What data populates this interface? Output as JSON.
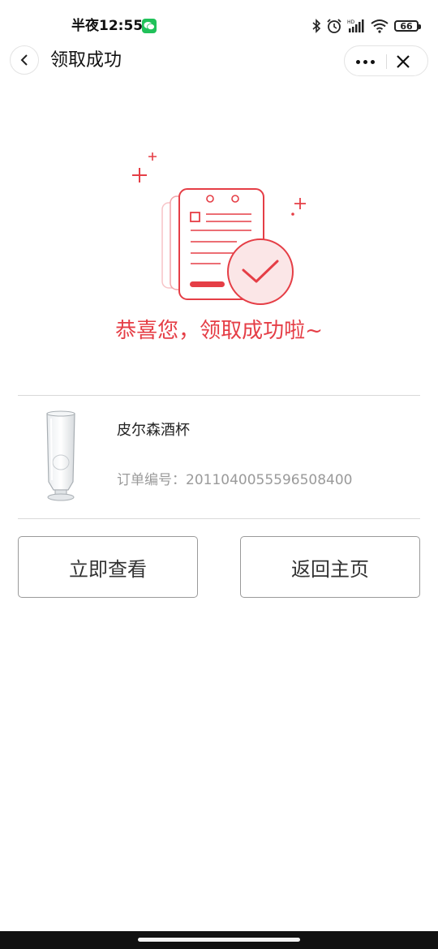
{
  "status_bar": {
    "time": "半夜12:55",
    "battery": "66"
  },
  "nav": {
    "title": "领取成功"
  },
  "result": {
    "message": "恭喜您，领取成功啦~"
  },
  "product": {
    "name": "皮尔森酒杯",
    "order_label": "订单编号：",
    "order_number": "2011040055596508400"
  },
  "buttons": {
    "view": "立即查看",
    "home": "返回主页"
  },
  "colors": {
    "accent": "#e53e46",
    "wechat": "#21c15a"
  }
}
